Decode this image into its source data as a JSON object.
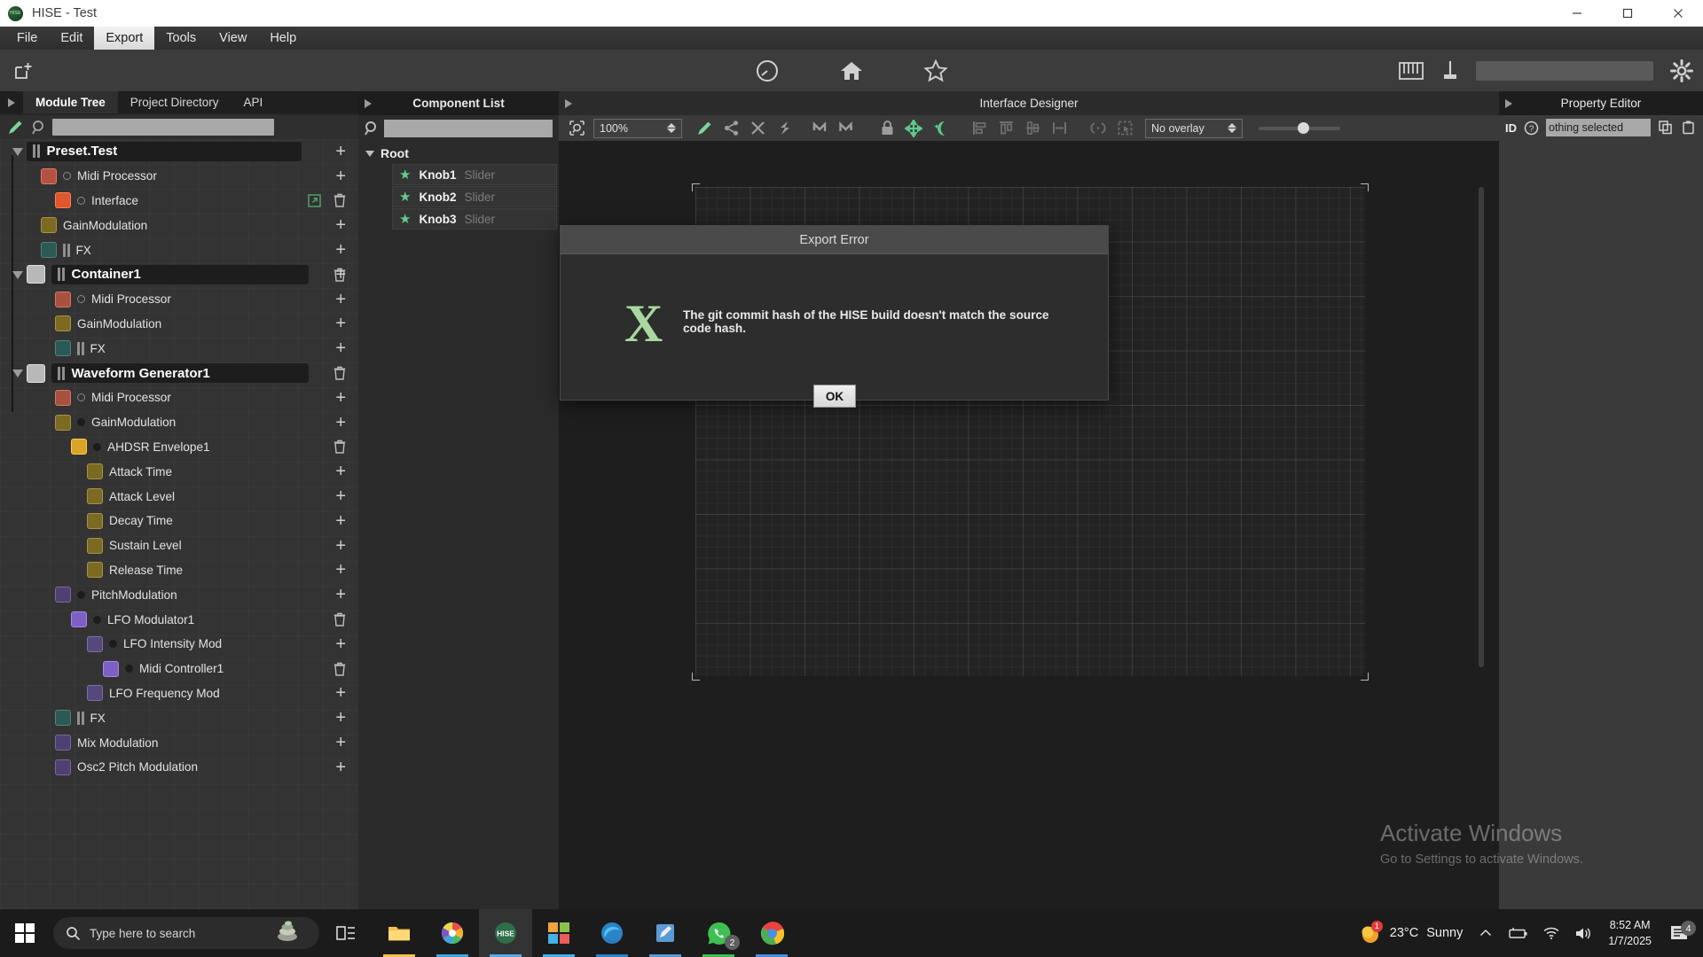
{
  "window": {
    "title": "HISE - Test",
    "logo_text": "HISE",
    "minimize": "—",
    "maximize": "▢",
    "close": "✕"
  },
  "menubar": {
    "items": [
      {
        "label": "File",
        "active": false
      },
      {
        "label": "Edit",
        "active": false
      },
      {
        "label": "Export",
        "active": true
      },
      {
        "label": "Tools",
        "active": false
      },
      {
        "label": "View",
        "active": false
      },
      {
        "label": "Help",
        "active": false
      }
    ]
  },
  "topstrip": {
    "new_doc_icon": "new-document-icon",
    "center_icons": [
      "gauge-icon",
      "home-icon",
      "star-icon"
    ],
    "right_icons": [
      "keyboard-icon",
      "plugin-icon",
      "settings-gear-icon"
    ]
  },
  "left_panel": {
    "tabs": [
      {
        "label": "Module Tree",
        "selected": true
      },
      {
        "label": "Project Directory",
        "selected": false
      },
      {
        "label": "API",
        "selected": false
      }
    ],
    "search_value": "",
    "search_placeholder": "",
    "tree": [
      {
        "label": "Preset.Test",
        "depth": 0,
        "style": "header",
        "arrow": "down",
        "grip": true,
        "plus": true
      },
      {
        "label": "Midi Processor",
        "depth": 1,
        "swatch": "#b35240",
        "dot": "ring",
        "plus": true
      },
      {
        "label": "Interface",
        "depth": 2,
        "swatch": "#e0562f",
        "dot": "ring",
        "extlink": true,
        "trash": true
      },
      {
        "label": "GainModulation",
        "depth": 1,
        "swatch": "#7d6a22",
        "plus": true
      },
      {
        "label": "FX",
        "depth": 1,
        "swatch": "#2b5a55",
        "grip": true,
        "plus": true
      },
      {
        "label": "Container1",
        "depth": 0,
        "style": "header",
        "arrow": "down",
        "swatch": "#b8b8b8",
        "grip": true,
        "plus": true,
        "trash": true
      },
      {
        "label": "Midi Processor",
        "depth": 2,
        "swatch": "#a9513f",
        "dot": "ring",
        "plus": true
      },
      {
        "label": "GainModulation",
        "depth": 2,
        "swatch": "#7d6a22",
        "plus": true
      },
      {
        "label": "FX",
        "depth": 2,
        "swatch": "#2b5a55",
        "grip": true,
        "plus": true
      },
      {
        "label": "Waveform Generator1",
        "depth": 0,
        "style": "header",
        "arrow": "down",
        "swatch": "#b8b8b8",
        "grip": true,
        "trash": true
      },
      {
        "label": "Midi Processor",
        "depth": 2,
        "swatch": "#a9513f",
        "dot": "ring",
        "plus": true
      },
      {
        "label": "GainModulation",
        "depth": 2,
        "swatch": "#7d6a22",
        "dot": "solid",
        "plus": true
      },
      {
        "label": "AHDSR Envelope1",
        "depth": 3,
        "swatch": "#d9a427",
        "dot": "solid",
        "trash": true
      },
      {
        "label": "Attack Time",
        "depth": 4,
        "swatch": "#7d6a22",
        "plus": true
      },
      {
        "label": "Attack Level",
        "depth": 4,
        "swatch": "#7d6a22",
        "plus": true
      },
      {
        "label": "Decay Time",
        "depth": 4,
        "swatch": "#7d6a22",
        "plus": true
      },
      {
        "label": "Sustain Level",
        "depth": 4,
        "swatch": "#7d6a22",
        "plus": true
      },
      {
        "label": "Release Time",
        "depth": 4,
        "swatch": "#7d6a22",
        "plus": true
      },
      {
        "label": "PitchModulation",
        "depth": 2,
        "swatch": "#4e4171",
        "dot": "solid",
        "plus": true
      },
      {
        "label": "LFO Modulator1",
        "depth": 3,
        "swatch": "#7e5fc4",
        "dot": "solid",
        "trash": true
      },
      {
        "label": "LFO Intensity Mod",
        "depth": 4,
        "swatch": "#55487d",
        "dot": "solid",
        "plus": true
      },
      {
        "label": "Midi Controller1",
        "depth": 5,
        "swatch": "#7e5fc4",
        "dot": "solid",
        "trash": true
      },
      {
        "label": "LFO Frequency Mod",
        "depth": 4,
        "swatch": "#55487d",
        "plus": true
      },
      {
        "label": "FX",
        "depth": 2,
        "swatch": "#2b5a55",
        "grip": true,
        "plus": true
      },
      {
        "label": "Mix Modulation",
        "depth": 2,
        "swatch": "#4e4171",
        "plus": true
      },
      {
        "label": "Osc2 Pitch Modulation",
        "depth": 2,
        "swatch": "#4e4171",
        "plus": true
      }
    ]
  },
  "component_list": {
    "title": "Component List",
    "search_value": "",
    "root_label": "Root",
    "items": [
      {
        "name": "Knob1",
        "type": "Slider"
      },
      {
        "name": "Knob2",
        "type": "Slider"
      },
      {
        "name": "Knob3",
        "type": "Slider"
      }
    ]
  },
  "interface_designer": {
    "title": "Interface Designer",
    "zoom_value": "100%",
    "overlay_value": "No overlay",
    "toolbar_icons": [
      "zoom-fit-icon",
      "edit-pencil-icon",
      "share-icon",
      "delete-x-icon",
      "undo-curve-icon",
      "undo-icon",
      "redo-icon",
      "lock-icon",
      "move-icon",
      "snap-icon",
      "align-left-icon",
      "align-top-icon",
      "align-middle-icon",
      "distribute-horizontal-icon",
      "brackets-icon",
      "select-region-icon"
    ]
  },
  "property_editor": {
    "title": "Property Editor",
    "id_label": "ID",
    "help_icon": "question-mark-icon",
    "value": "othing selected",
    "copy_icon": "copy-icon",
    "paste_icon": "paste-icon"
  },
  "dialog": {
    "title": "Export Error",
    "icon_glyph": "X",
    "icon_name": "error-x-icon",
    "message": "The git commit hash of the HISE build doesn't match the source code hash.",
    "ok_label": "OK"
  },
  "watermark": {
    "line1": "Activate Windows",
    "line2": "Go to Settings to activate Windows."
  },
  "taskbar": {
    "start_icon": "windows-start-icon",
    "search_placeholder": "Type here to search",
    "cortana_icon": "cortana-icon",
    "task_view_icon": "task-view-icon",
    "apps": [
      {
        "name": "file-explorer",
        "active": false
      },
      {
        "name": "photos-app",
        "active": false
      },
      {
        "name": "hise-app",
        "active": true
      },
      {
        "name": "store-app",
        "active": false
      },
      {
        "name": "edge-browser",
        "active": false
      },
      {
        "name": "text-editor",
        "active": false
      },
      {
        "name": "whatsapp",
        "active": false,
        "badge": "2"
      },
      {
        "name": "chrome-browser",
        "active": false
      }
    ],
    "tray": {
      "weather_temp": "23°C",
      "weather_cond": "Sunny",
      "chevron_icon": "chevron-up-icon",
      "icons": [
        "battery-icon",
        "wifi-icon",
        "volume-icon"
      ],
      "time": "8:52 AM",
      "date": "1/7/2025",
      "notification_icon": "notification-icon",
      "notification_count": "4"
    }
  }
}
